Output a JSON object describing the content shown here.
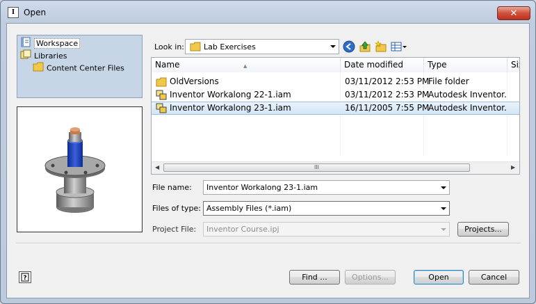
{
  "window": {
    "title": "Open",
    "app_icon_text": "I",
    "close_glyph": "✕"
  },
  "places": [
    {
      "label": "Workspace",
      "icon": "workspace-book-icon",
      "selected": true
    },
    {
      "label": "Libraries",
      "icon": "libraries-icon",
      "selected": false
    },
    {
      "label": "Content Center Files",
      "icon": "folder-icon",
      "selected": false
    }
  ],
  "lookin": {
    "label": "Look in:",
    "value": "Lab Exercises"
  },
  "toolbar": [
    "back-icon",
    "up-folder-icon",
    "new-folder-icon",
    "views-menu-icon"
  ],
  "filelist": {
    "columns": [
      "Name",
      "Date modified",
      "Type",
      "Size"
    ],
    "rows": [
      {
        "name": "OldVersions",
        "date": "03/11/2012 2:53 PM",
        "type": "File folder",
        "icon": "folder-icon",
        "selected": false
      },
      {
        "name": "Inventor Workalong 22-1.iam",
        "date": "03/11/2012 2:53 PM",
        "type": "Autodesk Inventor...",
        "icon": "assembly-file-icon",
        "selected": false
      },
      {
        "name": "Inventor Workalong 23-1.iam",
        "date": "16/11/2005 7:55 PM",
        "type": "Autodesk Inventor...",
        "icon": "assembly-file-icon",
        "selected": true
      }
    ],
    "scroll_grip": "III"
  },
  "form": {
    "filename_label": "File name:",
    "filename_value": "Inventor Workalong 23-1.iam",
    "filetype_label": "Files of type:",
    "filetype_value": "Assembly Files (*.iam)",
    "project_label": "Project File:",
    "project_value": "Inventor Course.ipj"
  },
  "buttons": {
    "projects": "Projects...",
    "find": "Find ...",
    "options": "Options...",
    "open": "Open",
    "cancel": "Cancel"
  },
  "colors": {
    "selection": "#d3e5f7",
    "places_bg": "#c7d6e6",
    "folder": "#f1c94a"
  }
}
